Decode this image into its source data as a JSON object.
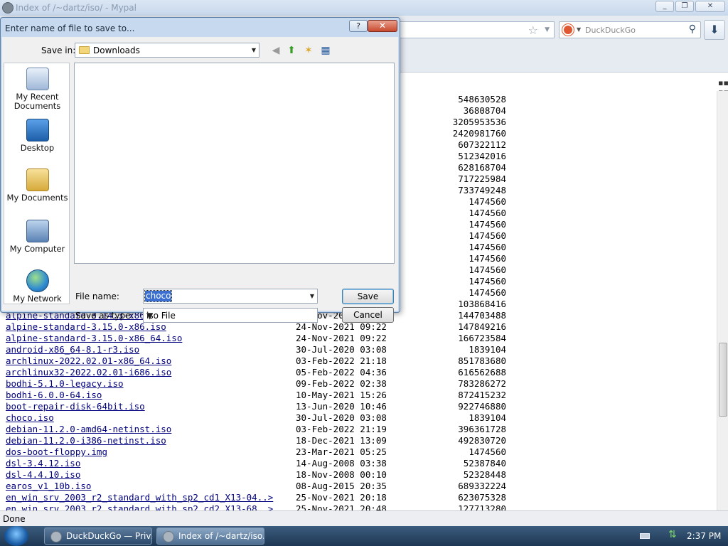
{
  "window": {
    "title": "Index of /~dartz/iso/ - Mypal",
    "min": "_",
    "max": "❐",
    "close": "✕"
  },
  "search": {
    "placeholder": "DuckDuckGo"
  },
  "files": [
    {
      "name": "",
      "date": "",
      "size": "548630528"
    },
    {
      "name": "",
      "date": "",
      "size": "36808704"
    },
    {
      "name": "",
      "date": "",
      "size": "3205953536"
    },
    {
      "name": "",
      "date": "",
      "size": "2420981760"
    },
    {
      "name": "",
      "date": "",
      "size": "607322112"
    },
    {
      "name": "",
      "date": "",
      "size": "512342016"
    },
    {
      "name": "",
      "date": "",
      "size": "628168704"
    },
    {
      "name": "",
      "date": "",
      "size": "717225984"
    },
    {
      "name": "",
      "date": "",
      "size": "733749248"
    },
    {
      "name": "",
      "date": "",
      "size": "1474560"
    },
    {
      "name": "",
      "date": "",
      "size": "1474560"
    },
    {
      "name": "",
      "date": "",
      "size": "1474560"
    },
    {
      "name": "",
      "date": "",
      "size": "1474560"
    },
    {
      "name": "",
      "date": "",
      "size": "1474560"
    },
    {
      "name": "",
      "date": "",
      "size": "1474560"
    },
    {
      "name": "",
      "date": "",
      "size": "1474560"
    },
    {
      "name": "",
      "date": "",
      "size": "1474560"
    },
    {
      "name": "",
      "date": "",
      "size": "1474560"
    },
    {
      "name": "",
      "date": "",
      "size": "103868416"
    },
    {
      "name": "alpine-standard-3.14.3-x86_64.iso",
      "date": "12-Nov-2021 09:22",
      "size": "144703488"
    },
    {
      "name": "alpine-standard-3.15.0-x86.iso",
      "date": "24-Nov-2021 09:22",
      "size": "147849216"
    },
    {
      "name": "alpine-standard-3.15.0-x86_64.iso",
      "date": "24-Nov-2021 09:22",
      "size": "166723584"
    },
    {
      "name": "android-x86_64-8.1-r3.iso",
      "date": "30-Jul-2020 03:08",
      "size": "1839104"
    },
    {
      "name": "archlinux-2022.02.01-x86_64.iso",
      "date": "03-Feb-2022 21:18",
      "size": "851783680"
    },
    {
      "name": "archlinux32-2022.02.01-i686.iso",
      "date": "05-Feb-2022 04:36",
      "size": "616562688"
    },
    {
      "name": "bodhi-5.1.0-legacy.iso",
      "date": "09-Feb-2022 02:38",
      "size": "783286272"
    },
    {
      "name": "bodhi-6.0.0-64.iso",
      "date": "10-May-2021 15:26",
      "size": "872415232"
    },
    {
      "name": "boot-repair-disk-64bit.iso",
      "date": "13-Jun-2020 10:46",
      "size": "922746880"
    },
    {
      "name": "choco.iso",
      "date": "30-Jul-2020 03:08",
      "size": "1839104"
    },
    {
      "name": "debian-11.2.0-amd64-netinst.iso",
      "date": "03-Feb-2022 21:19",
      "size": "396361728"
    },
    {
      "name": "debian-11.2.0-i386-netinst.iso",
      "date": "18-Dec-2021 13:09",
      "size": "492830720"
    },
    {
      "name": "dos-boot-floppy.img",
      "date": "23-Mar-2021 05:25",
      "size": "1474560"
    },
    {
      "name": "dsl-3.4.12.iso",
      "date": "14-Aug-2008 03:38",
      "size": "52387840"
    },
    {
      "name": "dsl-4.4.10.iso",
      "date": "18-Nov-2008 00:10",
      "size": "52328448"
    },
    {
      "name": "earos_v1_10b.iso",
      "date": "08-Aug-2015 20:35",
      "size": "689332224"
    },
    {
      "name": "en_win_srv_2003_r2_standard_with_sp2_cd1_X13-04..>",
      "date": "25-Nov-2021 20:18",
      "size": "623075328"
    },
    {
      "name": "en_win_srv_2003_r2_standard_with_sp2_cd2_X13-68..>",
      "date": "25-Nov-2021 20:48",
      "size": "127713280"
    }
  ],
  "status": "Done",
  "taskbar": {
    "tasks": [
      {
        "label": "DuckDuckGo — Priv..."
      },
      {
        "label": "Index of /~dartz/iso..."
      }
    ],
    "clock": "2:37 PM"
  },
  "dialog": {
    "title": "Enter name of file to save to...",
    "help": "?",
    "close": "✕",
    "save_in_label": "Save in:",
    "save_in_value": "Downloads",
    "places": [
      "My Recent Documents",
      "Desktop",
      "My Documents",
      "My Computer",
      "My Network"
    ],
    "file_name_label": "File name:",
    "file_name_value": "choco",
    "save_type_label": "Save as type:",
    "save_type_value": "iso File",
    "save_button": "Save",
    "cancel_button": "Cancel"
  }
}
